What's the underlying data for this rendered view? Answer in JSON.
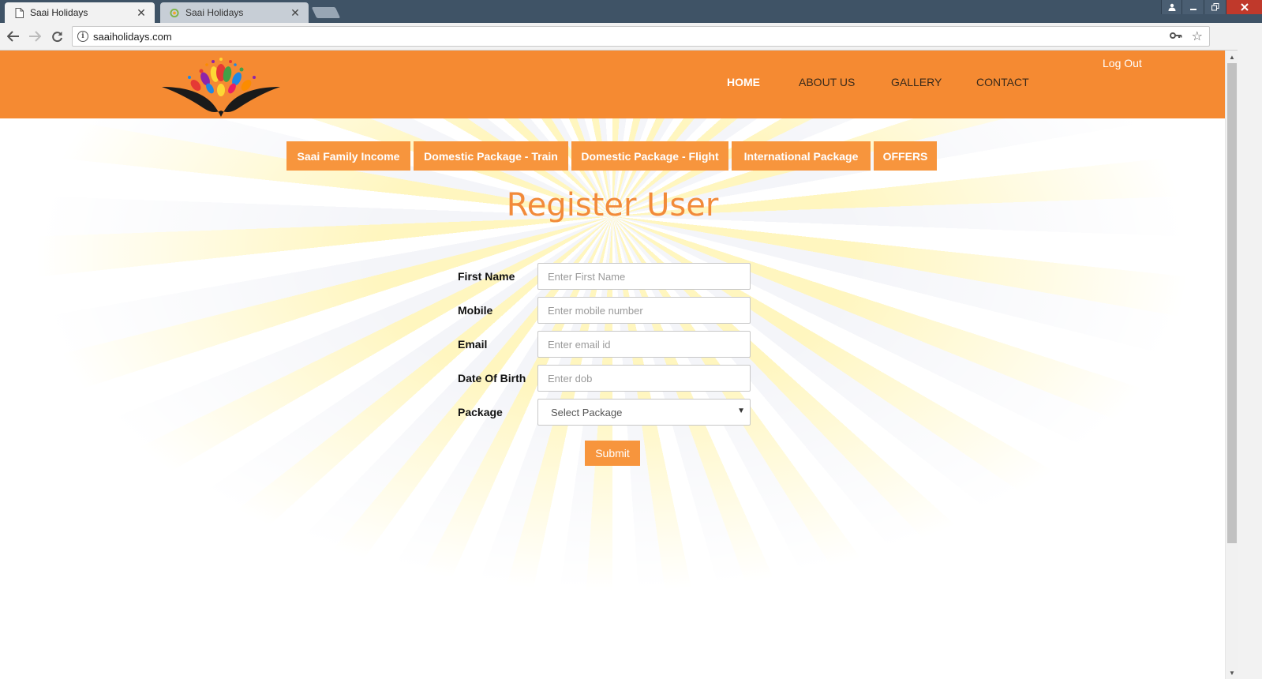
{
  "browser": {
    "tabs": [
      {
        "title": "Saai Holidays",
        "active": true
      },
      {
        "title": "Saai Holidays",
        "active": false
      }
    ],
    "close_glyph": "✕",
    "url": "saaiholidays.com",
    "icons": {
      "back": "back-arrow-icon",
      "forward": "forward-arrow-icon",
      "reload": "reload-icon",
      "key": "key-icon",
      "star": "star-icon",
      "menu": "more-vert-icon"
    }
  },
  "header": {
    "bg_color": "#f58a32",
    "logout": "Log Out",
    "nav": [
      {
        "label": "HOME",
        "active": true
      },
      {
        "label": "ABOUT US",
        "active": false
      },
      {
        "label": "GALLERY",
        "active": false
      },
      {
        "label": "CONTACT",
        "active": false
      }
    ]
  },
  "package_tabs": [
    "Saai Family Income",
    "Domestic Package - Train",
    "Domestic Package - Flight",
    "International Package",
    "OFFERS"
  ],
  "accent_color": "#f7953d",
  "title": "Register User",
  "form": {
    "fields": [
      {
        "label": "First Name",
        "placeholder": "Enter First Name",
        "value": ""
      },
      {
        "label": "Mobile",
        "placeholder": "Enter mobile number",
        "value": ""
      },
      {
        "label": "Email",
        "placeholder": "Enter email id",
        "value": ""
      },
      {
        "label": "Date Of Birth",
        "placeholder": "Enter dob",
        "value": ""
      }
    ],
    "package": {
      "label": "Package",
      "selected": "Select Package"
    },
    "submit": "Submit"
  }
}
